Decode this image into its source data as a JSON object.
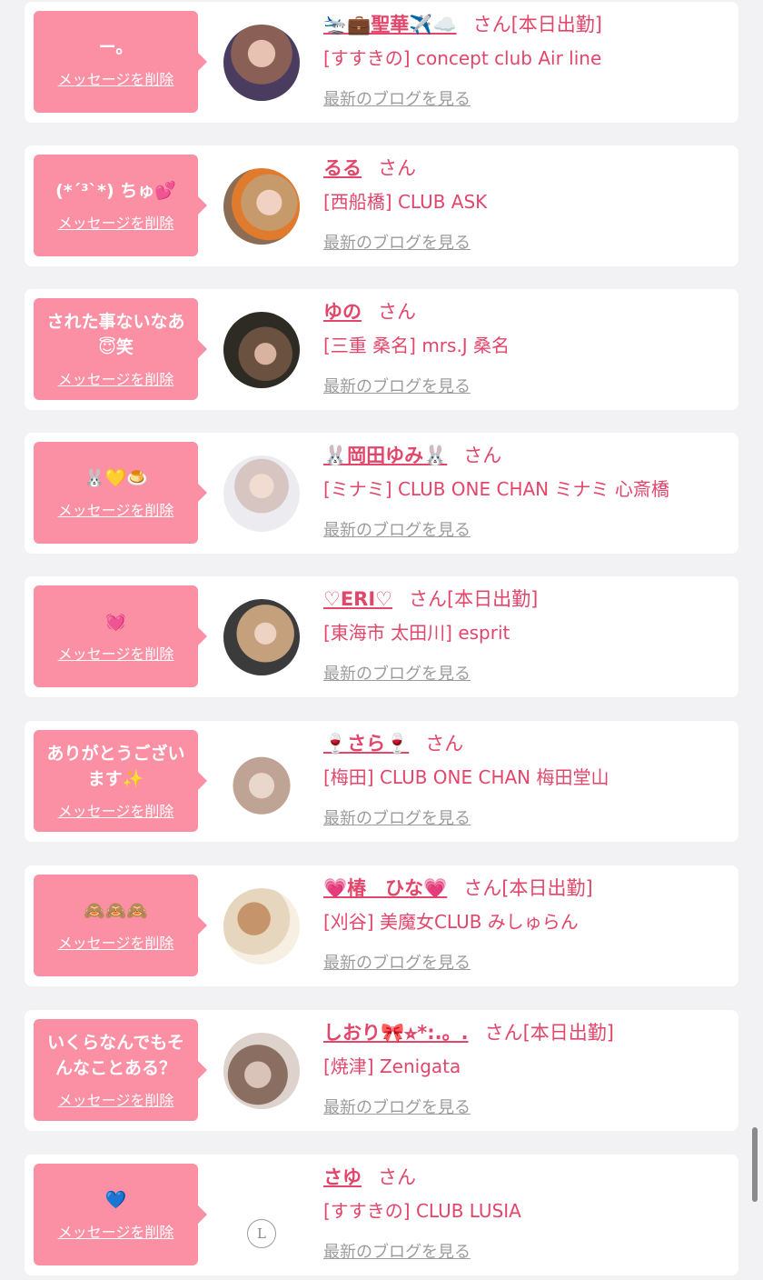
{
  "delete_label": "メッセージを削除",
  "blog_label": "最新のブログを見る",
  "san_label": "さん",
  "accent_color": "#fb8fa3",
  "name_color": "#e2466b",
  "items": [
    {
      "message": "ー。",
      "name": "🛬💼聖華✈️☁️",
      "status": "[本日出勤]",
      "shop": "[すすきの] concept club Air line",
      "avatar_color": "#5a4a6a"
    },
    {
      "message": "(*´³`*) ちゅ💕",
      "name": "るる",
      "status": "",
      "shop": "[西船橋] CLUB ASK",
      "avatar_color": "#d9a06a"
    },
    {
      "message": "された事ないなあ😇笑",
      "name": "ゆの",
      "status": "",
      "shop": "[三重 桑名] mrs.J 桑名",
      "avatar_color": "#4a3b30"
    },
    {
      "message": "🐰💛🍮",
      "name": "🐰岡田ゆみ🐰",
      "status": "",
      "shop": "[ミナミ] CLUB ONE CHAN ミナミ 心斎橋",
      "avatar_color": "#cfcfd4"
    },
    {
      "message": "💓",
      "name": "♡ERI♡",
      "status": "[本日出勤]",
      "shop": "[東海市 太田川] esprit",
      "avatar_color": "#6e5e52"
    },
    {
      "message": "ありがとうございます✨",
      "name": "🍷さら🍷",
      "status": "",
      "shop": "[梅田] CLUB ONE CHAN 梅田堂山",
      "avatar_color": "#b8a89c"
    },
    {
      "message": "🙈🙈🙈",
      "name": "💗椿　ひな💗",
      "status": "[本日出勤]",
      "shop": "[刈谷] 美魔女CLUB みしゅらん",
      "avatar_color": "#e9dcc8"
    },
    {
      "message": "いくらなんでもそんなことある？",
      "name": "しおり🎀⭐︎*:.。.",
      "status": "[本日出勤]",
      "shop": "[焼津] Zenigata",
      "avatar_color": "#c7b7ac"
    },
    {
      "message": "💙",
      "name": "さゆ",
      "status": "",
      "shop": "[すすきの] CLUB LUSIA",
      "avatar_color": "#ffffff",
      "logo": "L"
    }
  ]
}
